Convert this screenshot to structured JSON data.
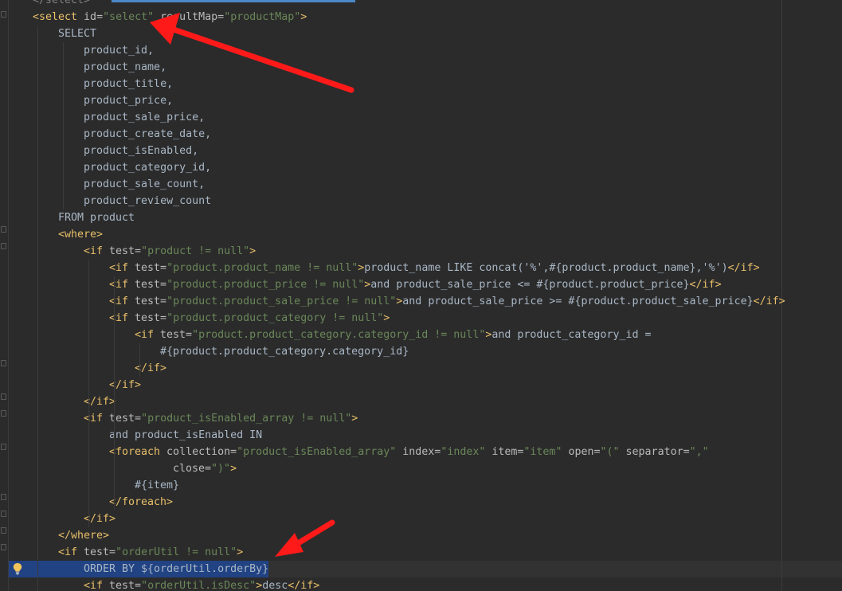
{
  "lines": [
    [
      "</select>"
    ],
    [
      "<select",
      " id=",
      "\"select\"",
      " resultMap=",
      "\"productMap\"",
      ">"
    ],
    [
      "SELECT"
    ],
    [
      "product_id,"
    ],
    [
      "product_name,"
    ],
    [
      "product_title,"
    ],
    [
      "product_price,"
    ],
    [
      "product_sale_price,"
    ],
    [
      "product_create_date,"
    ],
    [
      "product_isEnabled,"
    ],
    [
      "product_category_id,"
    ],
    [
      "product_sale_count,"
    ],
    [
      "product_review_count"
    ],
    [
      "FROM product"
    ],
    [
      "<where>"
    ],
    [
      "<if",
      " test=",
      "\"product != null\"",
      ">"
    ],
    [
      "<if",
      " test=",
      "\"product.product_name != null\"",
      ">",
      "product_name LIKE concat('%',#{product.product_name},'%')",
      "</if>"
    ],
    [
      "<if",
      " test=",
      "\"product.product_price != null\"",
      ">",
      "and product_sale_price <= #{product.product_price}",
      "</if>"
    ],
    [
      "<if",
      " test=",
      "\"product.product_sale_price != null\"",
      ">",
      "and product_sale_price >= #{product.product_sale_price}",
      "</if>"
    ],
    [
      "<if",
      " test=",
      "\"product.product_category != null\"",
      ">"
    ],
    [
      "<if",
      " test=",
      "\"product.product_category.category_id != null\"",
      ">",
      "and product_category_id ="
    ],
    [
      "#{product.product_category.category_id}"
    ],
    [
      "</if>"
    ],
    [
      "</if>"
    ],
    [
      "</if>"
    ],
    [
      "<if",
      " test=",
      "\"product_isEnabled_array != null\"",
      ">"
    ],
    [
      "and product_isEnabled IN"
    ],
    [
      "<foreach",
      " collection=",
      "\"product_isEnabled_array\"",
      " index=",
      "\"index\"",
      " item=",
      "\"item\"",
      " open=",
      "\"(\"",
      " separator=",
      "\",\""
    ],
    [
      " close=",
      "\")\"",
      ">"
    ],
    [
      "#{item}"
    ],
    [
      "</foreach>"
    ],
    [
      "</if>"
    ],
    [
      "</where>"
    ],
    [
      "<if",
      " test=",
      "\"orderUtil != null\"",
      ">"
    ],
    [
      "ORDER BY ${orderUtil.orderBy}"
    ],
    [
      "<if",
      " test=",
      "\"orderUtil.isDesc\"",
      ">",
      "desc",
      "</if>"
    ]
  ],
  "theme": {
    "background": "#2b2b2b",
    "tag": "#e8bf6a",
    "attribute": "#bababa",
    "string": "#6a8759",
    "text": "#a9b7c6",
    "selection": "#214283",
    "arrow": "#ff1a1a",
    "bulb": "#f2c55c"
  },
  "icons": {
    "intention_bulb": "lightbulb-icon",
    "annotation_arrows": "red-arrow-icon"
  }
}
